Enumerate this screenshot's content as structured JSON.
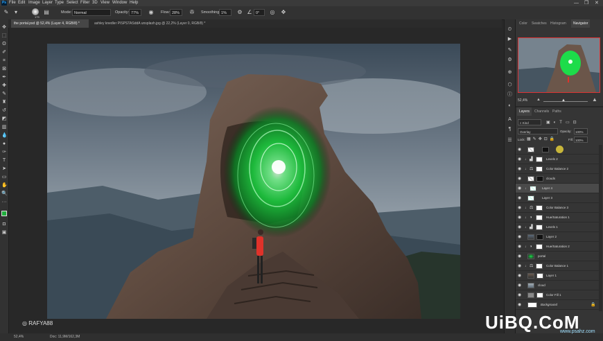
{
  "app": {
    "logo": "Ps"
  },
  "menu": [
    "File",
    "Edit",
    "Image",
    "Layer",
    "Type",
    "Select",
    "Filter",
    "3D",
    "View",
    "Window",
    "Help"
  ],
  "window_controls": {
    "minimize": "—",
    "maximize": "❐",
    "close": "✕"
  },
  "options": {
    "brush_size": "175",
    "mode_label": "Mode:",
    "mode_value": "Normal",
    "opacity_label": "Opacity:",
    "opacity_value": "77%",
    "flow_label": "Flow:",
    "flow_value": "28%",
    "smoothing_label": "Smoothing:",
    "smoothing_value": "1%",
    "angle_value": "0°"
  },
  "tabs": [
    {
      "label": "the portal.psd @ 52,4% (Layer 4, RGB/8) *"
    },
    {
      "label": "ashley knedler PISPSTASddA unsplash.jpg @ 22,2% (Layer 0, RGB/8) *"
    }
  ],
  "watermark": "RAFYA88",
  "status": {
    "zoom": "52,4%",
    "doc": "Doc: 11,9M/162,3M"
  },
  "nav_panel": {
    "tabs": [
      "Color",
      "Swatches",
      "Histogram",
      "Navigator"
    ],
    "zoom": "52,4%"
  },
  "layers_panel": {
    "tabs": [
      "Layers",
      "Channels",
      "Paths"
    ],
    "filter_label": "Kind",
    "blend_mode": "Overlay",
    "opacity_label": "Opacity:",
    "opacity_value": "100%",
    "lock_label": "Lock:",
    "fill_label": "Fill:",
    "fill_value": "100%",
    "layers": [
      {
        "name": ""
      },
      {
        "name": "Levels 2"
      },
      {
        "name": "Color Balance 2"
      },
      {
        "name": "clouds"
      },
      {
        "name": "Layer 4"
      },
      {
        "name": "Layer 3"
      },
      {
        "name": "Color Balance 3"
      },
      {
        "name": "Hue/Saturation 1"
      },
      {
        "name": "Levels 1"
      },
      {
        "name": "Layer 2"
      },
      {
        "name": "Hue/Saturation 2"
      },
      {
        "name": "portal"
      },
      {
        "name": "Color Balance 1"
      },
      {
        "name": "Layer 1"
      },
      {
        "name": "cloud"
      },
      {
        "name": "Color Fill 1"
      },
      {
        "name": "Background"
      }
    ]
  },
  "site_watermark": {
    "logo": "UiBQ.CoM",
    "sub": "www.psahz.com"
  },
  "colors": {
    "accent": "#31a8ff",
    "portal_green": "#2bff6a",
    "nav_frame": "#dd3333"
  }
}
